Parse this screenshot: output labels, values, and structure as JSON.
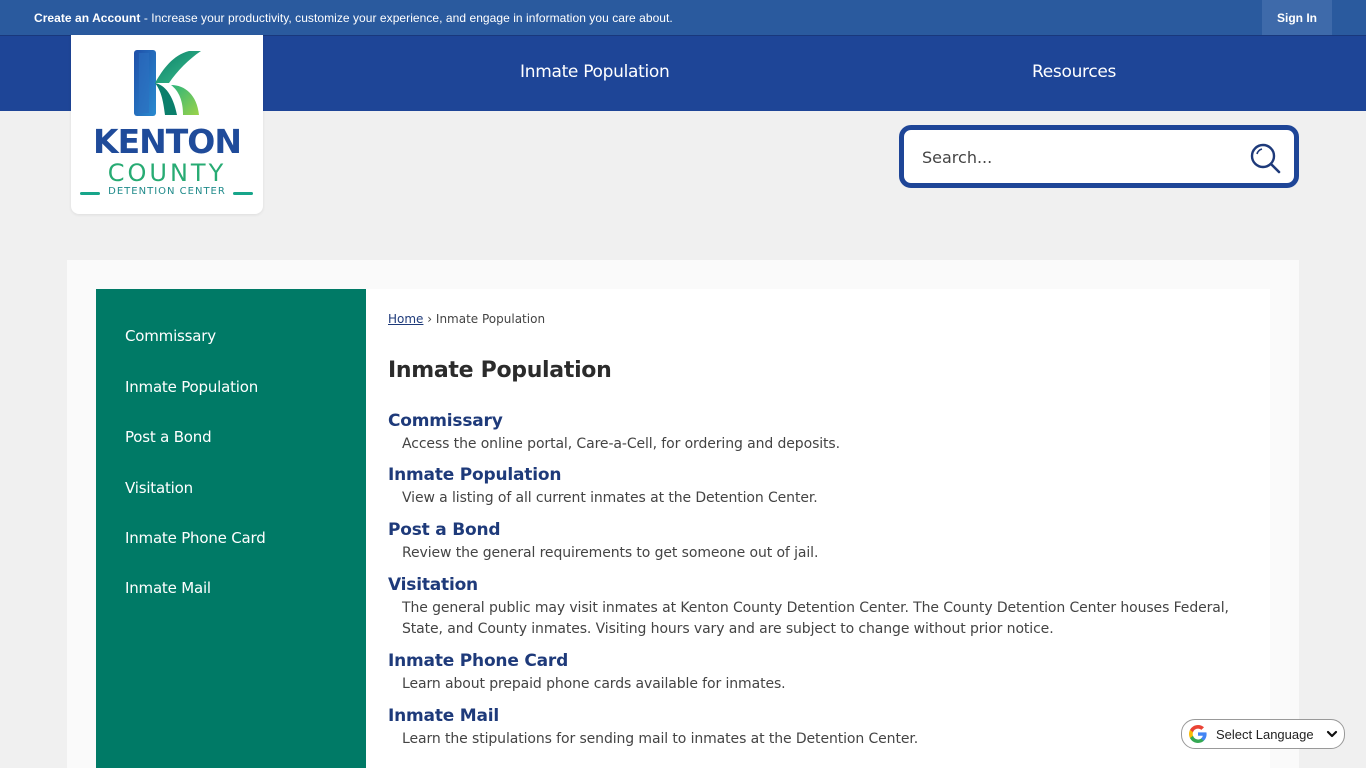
{
  "topbar": {
    "create_account": "Create an Account",
    "message": " - Increase your productivity, customize your experience, and engage in information you care about.",
    "sign_in": "Sign In"
  },
  "nav": {
    "items": [
      {
        "label": "Inmate Population"
      },
      {
        "label": "Resources"
      }
    ]
  },
  "logo": {
    "line1": "KENTON",
    "line2": "COUNTY",
    "line3": "DETENTION CENTER",
    "icon": "kenton-k-logo-icon"
  },
  "search": {
    "placeholder": "Search...",
    "icon": "search-icon"
  },
  "sidebar": {
    "items": [
      {
        "label": "Commissary"
      },
      {
        "label": "Inmate Population"
      },
      {
        "label": "Post a Bond"
      },
      {
        "label": "Visitation"
      },
      {
        "label": "Inmate Phone Card"
      },
      {
        "label": "Inmate Mail"
      }
    ]
  },
  "breadcrumb": {
    "home": "Home",
    "separator": "›",
    "current": "Inmate Population"
  },
  "page_title": "Inmate Population",
  "entries": [
    {
      "title": "Commissary",
      "desc": "Access the online portal, Care-a-Cell, for ordering and deposits."
    },
    {
      "title": "Inmate Population",
      "desc": "View a listing of all current inmates at the Detention Center."
    },
    {
      "title": "Post a Bond",
      "desc": "Review the general requirements to get someone out of jail."
    },
    {
      "title": "Visitation",
      "desc": "The general public may visit inmates at Kenton County Detention Center. The County Detention Center houses Federal, State, and County inmates. Visiting hours vary and are subject to change without prior notice."
    },
    {
      "title": "Inmate Phone Card",
      "desc": "Learn about prepaid phone cards available for inmates."
    },
    {
      "title": "Inmate Mail",
      "desc": "Learn the stipulations for sending mail to inmates at the Detention Center."
    }
  ],
  "language": {
    "label": "Select Language",
    "icon": "google-icon"
  },
  "colors": {
    "topbar": "#2a5a9e",
    "nav": "#1e4597",
    "sidebar": "#007a66",
    "link": "#1e3a7a",
    "county_green": "#27ab73"
  }
}
